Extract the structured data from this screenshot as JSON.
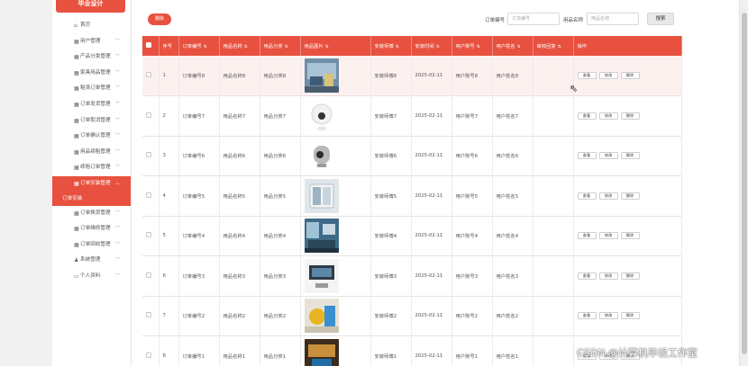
{
  "brand": "毕业设计",
  "sidebar": {
    "items": [
      {
        "label": "首页",
        "icon": "home-icon",
        "glyph": "⌂"
      },
      {
        "label": "用户管理",
        "icon": "grid-icon",
        "glyph": "▦"
      },
      {
        "label": "产品分类管理",
        "icon": "grid-icon",
        "glyph": "▦"
      },
      {
        "label": "家具用品管理",
        "icon": "grid-icon",
        "glyph": "▦"
      },
      {
        "label": "租赁订单管理",
        "icon": "grid-icon",
        "glyph": "▦"
      },
      {
        "label": "订单发货管理",
        "icon": "grid-icon",
        "glyph": "▦"
      },
      {
        "label": "订单取消管理",
        "icon": "grid-icon",
        "glyph": "▦"
      },
      {
        "label": "订单确认管理",
        "icon": "grid-icon",
        "glyph": "▦"
      },
      {
        "label": "用品续租管理",
        "icon": "grid-icon",
        "glyph": "▦"
      },
      {
        "label": "续租订单管理",
        "icon": "grid-icon",
        "glyph": "▦"
      },
      {
        "label": "订单安装管理",
        "icon": "grid-icon",
        "glyph": "▦"
      },
      {
        "label": "订单安装",
        "icon": "",
        "glyph": ""
      },
      {
        "label": "订单换货管理",
        "icon": "grid-icon",
        "glyph": "▦"
      },
      {
        "label": "订单维修管理",
        "icon": "grid-icon",
        "glyph": "▦"
      },
      {
        "label": "订单回收管理",
        "icon": "grid-icon",
        "glyph": "▦"
      },
      {
        "label": "系统管理",
        "icon": "user-icon",
        "glyph": "♟"
      },
      {
        "label": "个人资料",
        "icon": "profile-icon",
        "glyph": "▭"
      }
    ]
  },
  "toolbar": {
    "delete_label": "删除",
    "order_no_label": "订单编号",
    "order_no_placeholder": "订单编号",
    "product_name_label": "用品名称",
    "product_name_placeholder": "用品名称",
    "search_label": "搜索"
  },
  "table": {
    "sort_glyph": "⇅",
    "columns": [
      "序号",
      "订单编号",
      "用品名称",
      "用品分类",
      "用品图片",
      "安装师傅",
      "安装时间",
      "用户账号",
      "用户姓名",
      "审核回复",
      "操作"
    ],
    "actions": {
      "view": "查看",
      "edit": "修改",
      "delete": "删除"
    },
    "rows": [
      {
        "no": "1",
        "order": "订单编号8",
        "name": "用品名称8",
        "category": "用品分类8",
        "installer": "安装师傅8",
        "time": "2025-02-11",
        "account": "用户账号8",
        "username": "用户姓名8",
        "reply": "",
        "thumb": "photo-blue-room"
      },
      {
        "no": "2",
        "order": "订单编号7",
        "name": "用品名称7",
        "category": "用品分类7",
        "installer": "安装师傅7",
        "time": "2025-02-11",
        "account": "用户账号7",
        "username": "用户姓名7",
        "reply": "",
        "thumb": "photo-white-sphere"
      },
      {
        "no": "3",
        "order": "订单编号6",
        "name": "用品名称6",
        "category": "用品分类6",
        "installer": "安装师傅6",
        "time": "2025-02-11",
        "account": "用户账号6",
        "username": "用户姓名6",
        "reply": "",
        "thumb": "photo-grey-camera"
      },
      {
        "no": "4",
        "order": "订单编号5",
        "name": "用品名称5",
        "category": "用品分类5",
        "installer": "安装师傅5",
        "time": "2025-02-11",
        "account": "用户账号5",
        "username": "用户姓名5",
        "reply": "",
        "thumb": "photo-wall-switch"
      },
      {
        "no": "5",
        "order": "订单编号4",
        "name": "用品名称4",
        "category": "用品分类4",
        "installer": "安装师傅4",
        "time": "2025-02-11",
        "account": "用户账号4",
        "username": "用户姓名4",
        "reply": "",
        "thumb": "photo-living-room"
      },
      {
        "no": "6",
        "order": "订单编号3",
        "name": "用品名称3",
        "category": "用品分类3",
        "installer": "安装师傅3",
        "time": "2025-02-11",
        "account": "用户账号3",
        "username": "用户姓名3",
        "reply": "",
        "thumb": "photo-device-panel"
      },
      {
        "no": "7",
        "order": "订单编号2",
        "name": "用品名称2",
        "category": "用品分类2",
        "installer": "安装师傅2",
        "time": "2025-02-11",
        "account": "用户账号2",
        "username": "用户姓名2",
        "reply": "",
        "thumb": "photo-yellow-blue"
      },
      {
        "no": "8",
        "order": "订单编号1",
        "name": "用品名称1",
        "category": "用品分类1",
        "installer": "安装师傅1",
        "time": "2025-02-11",
        "account": "用户账号1",
        "username": "用户姓名1",
        "reply": "",
        "thumb": "photo-warm-interior"
      }
    ]
  },
  "watermark": "CSDN @计算机毕设工作室",
  "colors": {
    "accent": "#e8513f",
    "row_highlight": "#fdf1f0"
  }
}
